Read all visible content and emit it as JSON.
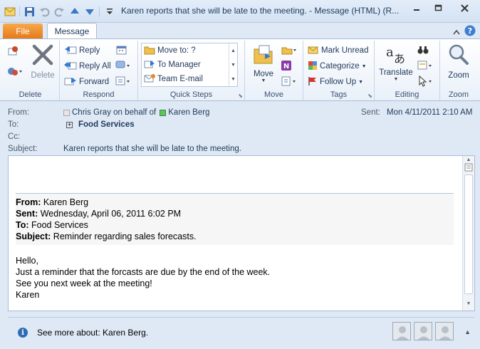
{
  "window": {
    "title": "Karen reports that she will be late to the meeting.  -  Message (HTML) (R..."
  },
  "tabs": {
    "file": "File",
    "message": "Message"
  },
  "ribbon": {
    "delete_group": {
      "label": "Delete",
      "delete": "Delete"
    },
    "respond_group": {
      "label": "Respond",
      "reply": "Reply",
      "reply_all": "Reply All",
      "forward": "Forward"
    },
    "quick_steps_group": {
      "label": "Quick Steps",
      "items": [
        "Move to: ?",
        "To Manager",
        "Team E-mail"
      ]
    },
    "move_group": {
      "label": "Move",
      "move": "Move"
    },
    "tags_group": {
      "label": "Tags",
      "mark_unread": "Mark Unread",
      "categorize": "Categorize",
      "follow_up": "Follow Up"
    },
    "editing_group": {
      "label": "Editing",
      "translate": "Translate"
    },
    "zoom_group": {
      "label": "Zoom",
      "zoom": "Zoom"
    }
  },
  "header": {
    "from_label": "From:",
    "from_sender": "Chris Gray on behalf of",
    "from_owner": "Karen Berg",
    "to_label": "To:",
    "to_value": "Food Services",
    "cc_label": "Cc:",
    "subject_label": "Subject:",
    "subject_value": "Karen reports that she will be late to the meeting.",
    "sent_label": "Sent:",
    "sent_value": "Mon 4/11/2011 2:10 AM"
  },
  "body": {
    "from_label": "From:",
    "from_value": "Karen Berg",
    "sent_label": "Sent:",
    "sent_value": "Wednesday, April 06, 2011 6:02 PM",
    "to_label": "To:",
    "to_value": "Food Services",
    "subject_label": "Subject:",
    "subject_value": "Reminder regarding sales forecasts.",
    "lines": [
      "Hello,",
      "Just a reminder that the forcasts are due by the end of the week.",
      "See you next week at the meeting!",
      "Karen"
    ]
  },
  "people_pane": {
    "see_more": "See more about: Karen Berg."
  },
  "colors": {
    "file_tab": "#e47b1b",
    "ribbon_bg": "#ffffff",
    "frame_bg": "#dfe9f5",
    "accent": "#1e395b"
  }
}
